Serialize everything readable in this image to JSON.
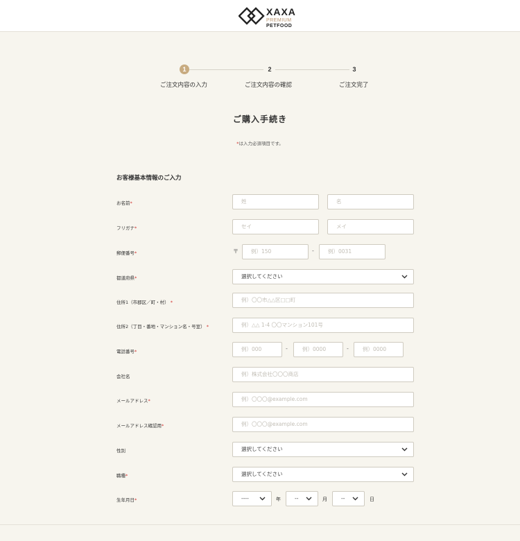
{
  "brand": {
    "name": "XAXA",
    "line1": "PREMIUM",
    "line2": "PETFOOD"
  },
  "colors": {
    "accent": "#c8ab80",
    "required": "#d0312d",
    "background": "#f7f5ee"
  },
  "steps": [
    {
      "number": "1",
      "label": "ご注文内容の入力"
    },
    {
      "number": "2",
      "label": "ご注文内容の確認"
    },
    {
      "number": "3",
      "label": "ご注文完了"
    }
  ],
  "page": {
    "title": "ご購入手続き",
    "required_star": "*",
    "required_note": "は入力必須項目です。"
  },
  "section": {
    "title": "お客様基本情報のご入力"
  },
  "form": {
    "name": {
      "label": "お名前",
      "last_placeholder": "姓",
      "first_placeholder": "名"
    },
    "kana": {
      "label": "フリガナ",
      "last_placeholder": "セイ",
      "first_placeholder": "メイ"
    },
    "postal": {
      "label": "郵便番号",
      "mark": "〒",
      "first_placeholder": "例）150",
      "dash": "-",
      "second_placeholder": "例）0031"
    },
    "prefecture": {
      "label": "都道府県",
      "value": "選択してください"
    },
    "address1": {
      "label": "住所1（市郡区／町・村）",
      "placeholder": "例）〇〇市△△区□□町"
    },
    "address2": {
      "label": "住所2（丁目・番地・マンション名・号室）",
      "placeholder": "例）△△ 1-4 〇〇マンション101号"
    },
    "phone": {
      "label": "電話番号",
      "first_placeholder": "例）000",
      "dash": "-",
      "second_placeholder": "例）0000",
      "third_placeholder": "例）0000"
    },
    "company": {
      "label": "会社名",
      "placeholder": "例）株式会社〇〇〇商店"
    },
    "email": {
      "label": "メールアドレス",
      "placeholder": "例）〇〇〇@example.com"
    },
    "email_confirm": {
      "label": "メールアドレス確認用",
      "placeholder": "例）〇〇〇@example.com"
    },
    "gender": {
      "label": "性別",
      "value": "選択してください"
    },
    "occupation": {
      "label": "職種",
      "value": "選択してください"
    },
    "birthday": {
      "label": "生年月日",
      "year_value": "----",
      "year_suffix": "年",
      "month_value": "--",
      "month_suffix": "月",
      "day_value": "--",
      "day_suffix": "日"
    }
  }
}
